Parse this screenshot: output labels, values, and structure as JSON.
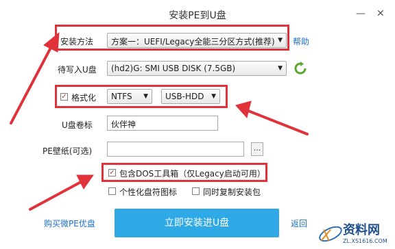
{
  "window": {
    "title": "安装PE到U盘",
    "minimize_glyph": "—",
    "close_glyph": "✕"
  },
  "install_method": {
    "label": "安装方法",
    "value": "方案一：UEFI/Legacy全能三分区方式(推荐)",
    "help": "帮助"
  },
  "target_disk": {
    "label": "待写入U盘",
    "value": "(hd2)G: SMI USB DISK (7.5GB)"
  },
  "format": {
    "label": "格式化",
    "checked": true,
    "fs": "NTFS",
    "mode": "USB-HDD"
  },
  "volume_label": {
    "label": "U盘卷标",
    "value": "伙伴神"
  },
  "wallpaper": {
    "label": "PE壁纸(可选)",
    "value": "",
    "browse": "..."
  },
  "dos_toolbox": {
    "label": "包含DOS工具箱（仅Legacy启动可用）",
    "checked": true
  },
  "personalize_icon": {
    "label": "个性化盘符图标",
    "checked": false
  },
  "copy_installer": {
    "label": "同时复制安装包",
    "checked": false
  },
  "footer": {
    "buy": "购买微PE优盘",
    "install": "立即安装进U盘",
    "back": "返回"
  },
  "watermark": {
    "brand": "资料网",
    "url": "ZL.XS1616.COM"
  },
  "colors": {
    "highlight": "#e0323a",
    "primary_button": "#2fa9e6",
    "link": "#1e6fc8"
  }
}
